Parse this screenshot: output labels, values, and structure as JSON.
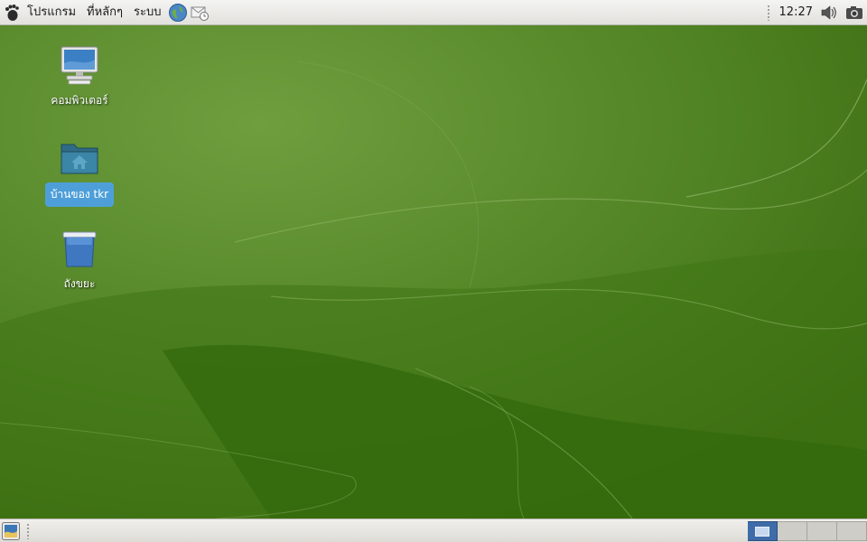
{
  "top_panel": {
    "menus": [
      {
        "label": "โปรแกรม"
      },
      {
        "label": "ที่หลักๆ"
      },
      {
        "label": "ระบบ"
      }
    ],
    "launchers": [
      "web-browser-icon",
      "mail-client-icon"
    ],
    "clock": "12:27",
    "tray": [
      "volume-icon",
      "screenshot-camera-icon"
    ]
  },
  "desktop": {
    "icons": [
      {
        "label": "คอมพิวเตอร์",
        "icon": "computer-icon",
        "selected": false
      },
      {
        "label": "บ้านของ tkr",
        "icon": "home-folder-icon",
        "selected": true
      },
      {
        "label": "ถังขยะ",
        "icon": "trash-icon",
        "selected": false
      }
    ],
    "wallpaper_colors": {
      "base": "#3f6e16",
      "light": "#6a9a3a",
      "dark": "#2f5a0c"
    }
  },
  "bottom_panel": {
    "workspaces_count": 4,
    "active_workspace": 1,
    "accent": "#3e6ca8"
  }
}
